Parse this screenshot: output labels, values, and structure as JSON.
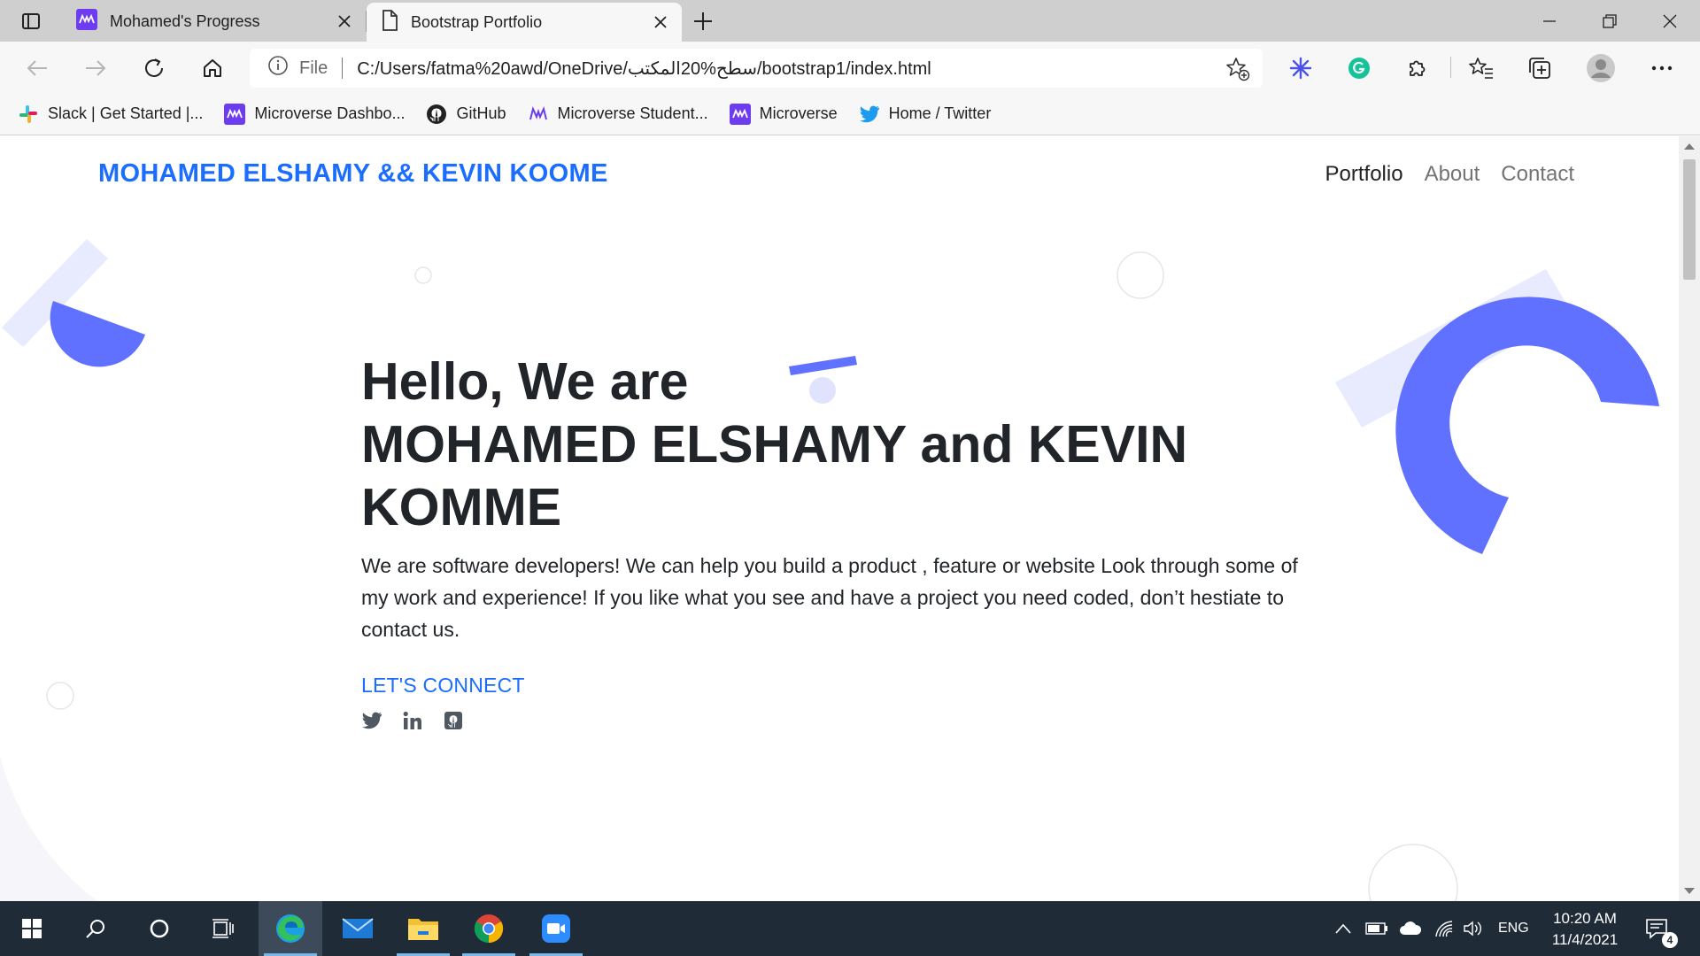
{
  "browser": {
    "tabs": [
      {
        "title": "Mohamed's Progress",
        "active": false,
        "icon": "microverse-icon"
      },
      {
        "title": "Bootstrap Portfolio",
        "active": true,
        "icon": "file-icon"
      }
    ],
    "address": {
      "scheme_label": "File",
      "url": "C:/Users/fatma%20awd/OneDrive/سطح%20المكتب/bootstrap1/index.html"
    },
    "bookmarks": [
      {
        "label": "Slack | Get Started |...",
        "icon": "slack-icon"
      },
      {
        "label": "Microverse Dashbo...",
        "icon": "microverse-icon"
      },
      {
        "label": "GitHub",
        "icon": "github-icon"
      },
      {
        "label": "Microverse Student...",
        "icon": "microverse-outline-icon"
      },
      {
        "label": "Microverse",
        "icon": "microverse-icon"
      },
      {
        "label": "Home / Twitter",
        "icon": "twitter-icon"
      }
    ]
  },
  "page": {
    "brand": "MOHAMED ELSHAMY && KEVIN KOOME",
    "nav": [
      {
        "label": "Portfolio",
        "active": true
      },
      {
        "label": "About",
        "active": false
      },
      {
        "label": "Contact",
        "active": false
      }
    ],
    "hero": {
      "heading_line1": "Hello, We are",
      "heading_line2": "MOHAMED ELSHAMY and KEVIN KOMME",
      "description": "We are software developers! We can help you build a product , feature or website Look through some of my work and experience! If you like what you see and have a project you need coded, don’t hestiate to contact us.",
      "cta": "LET'S CONNECT",
      "socials": [
        "twitter-icon",
        "linkedin-icon",
        "github-icon"
      ]
    },
    "colors": {
      "accent": "#1a6dff",
      "shape": "#6070ff",
      "shape_light": "#e8eafd"
    }
  },
  "taskbar": {
    "apps": [
      "start",
      "search",
      "cortana",
      "task-view",
      "edge",
      "mail",
      "file-explorer",
      "chrome",
      "zoom"
    ],
    "language": "ENG",
    "time": "10:20 AM",
    "date": "11/4/2021",
    "notifications": "4"
  }
}
